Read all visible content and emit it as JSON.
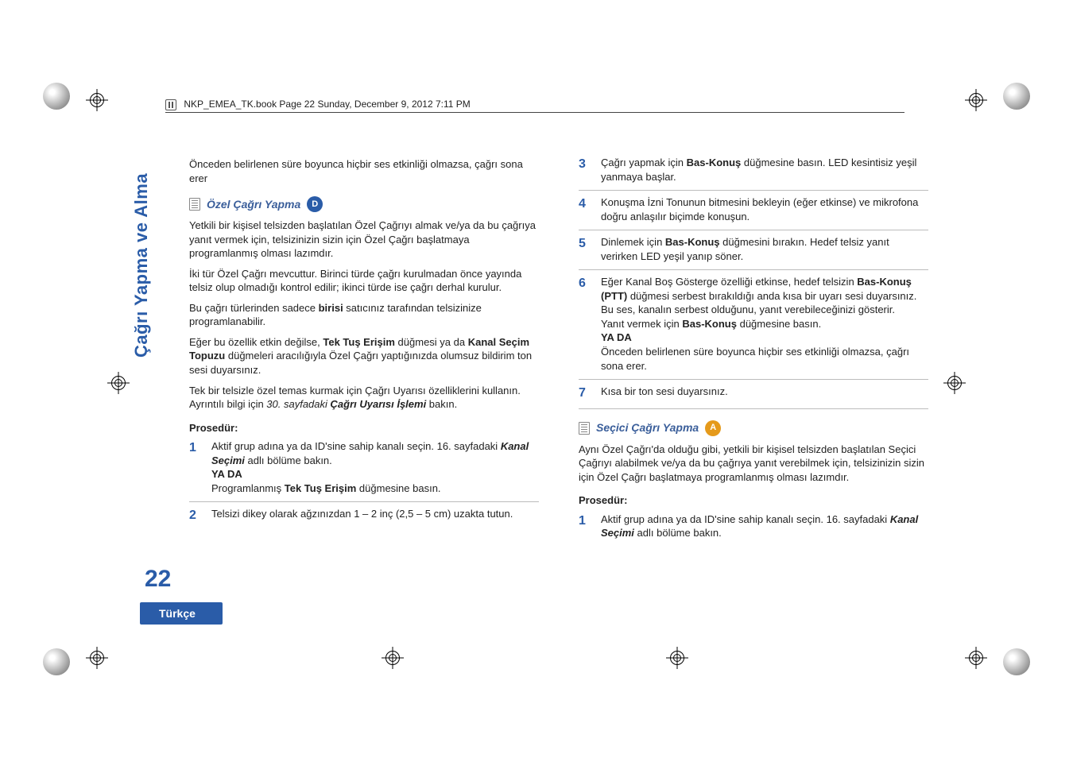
{
  "header": {
    "text": "NKP_EMEA_TK.book  Page 22  Sunday, December 9, 2012  7:11 PM"
  },
  "side_label": "Çağrı Yapma ve Alma",
  "page_number": "22",
  "language_tab": "Türkçe",
  "left": {
    "intro_continuation": "Önceden belirlenen süre boyunca hiçbir ses etkinliği olmazsa, çağrı sona erer",
    "heading": "Özel Çağrı Yapma",
    "badge": "D",
    "p1": "Yetkili bir kişisel telsizden başlatılan Özel Çağrıyı almak ve/ya da bu çağrıya yanıt vermek için, telsizinizin sizin için Özel Çağrı başlatmaya programlanmış olması lazımdır.",
    "p2": "İki tür Özel Çağrı mevcuttur. Birinci türde çağrı kurulmadan önce yayında telsiz olup olmadığı kontrol edilir; ikinci türde ise çağrı derhal kurulur.",
    "p3_a": "Bu çağrı türlerinden sadece ",
    "p3_bold": "birisi",
    "p3_b": " satıcınız tarafından telsizinize programlanabilir.",
    "p4_a": "Eğer bu özellik etkin değilse, ",
    "p4_b1": "Tek Tuş Erişim",
    "p4_b": " düğmesi ya da ",
    "p4_b2": "Kanal Seçim Topuzu",
    "p4_c": " düğmeleri aracılığıyla Özel Çağrı yaptığınızda olumsuz bildirim ton sesi duyarsınız.",
    "p5_a": "Tek bir telsizle özel temas kurmak için Çağrı Uyarısı özelliklerini kullanın. Ayrıntılı bilgi için ",
    "p5_i": "30. sayfadaki ",
    "p5_bi": "Çağrı Uyarısı İşlemi",
    "p5_b": " bakın.",
    "procedure_label": "Prosedür:",
    "steps": [
      {
        "num": "1",
        "a": "Aktif grup adına ya da ID'sine sahip kanalı seçin. 16. sayfadaki ",
        "bi": "Kanal Seçimi",
        "b": " adlı bölüme bakın.",
        "or": "YA DA",
        "c1": "Programlanmış ",
        "c_bold": "Tek Tuş Erişim",
        "c2": " düğmesine basın."
      },
      {
        "num": "2",
        "a": "Telsizi dikey olarak ağzınızdan 1 – 2 inç (2,5 – 5 cm) uzakta tutun."
      }
    ]
  },
  "right": {
    "steps": [
      {
        "num": "3",
        "a": "Çağrı yapmak için ",
        "bold": "Bas-Konuş",
        "b": " düğmesine basın. LED kesintisiz yeşil yanmaya başlar."
      },
      {
        "num": "4",
        "a": "Konuşma İzni Tonunun bitmesini bekleyin (eğer etkinse) ve mikrofona doğru anlaşılır biçimde konuşun."
      },
      {
        "num": "5",
        "a": "Dinlemek için ",
        "bold": "Bas-Konuş",
        "b": " düğmesini bırakın. Hedef telsiz yanıt verirken LED yeşil yanıp söner."
      },
      {
        "num": "6",
        "a": "Eğer Kanal Boş Gösterge özelliği etkinse, hedef telsizin ",
        "bold1": "Bas-Konuş (PTT)",
        "b": " düğmesi serbest bırakıldığı anda kısa bir uyarı sesi duyarsınız. Bu ses, kanalın serbest olduğunu, yanıt verebileceğinizi gösterir.",
        "c1": "Yanıt vermek için ",
        "bold2": "Bas-Konuş",
        "c2": " düğmesine basın.",
        "or": "YA DA",
        "d": "Önceden belirlenen süre boyunca hiçbir ses etkinliği olmazsa, çağrı sona erer."
      },
      {
        "num": "7",
        "a": "Kısa bir ton sesi duyarsınız."
      }
    ],
    "heading2": "Seçici Çağrı Yapma",
    "badge2": "A",
    "p1": "Aynı Özel Çağrı'da olduğu gibi, yetkili bir kişisel telsizden başlatılan Seçici Çağrıyı alabilmek ve/ya da bu çağrıya yanıt verebilmek için, telsizinizin sizin için Özel Çağrı başlatmaya programlanmış olması lazımdır.",
    "procedure_label": "Prosedür:",
    "step1": {
      "num": "1",
      "a": "Aktif grup adına ya da ID'sine sahip kanalı seçin. 16. sayfadaki ",
      "bi": "Kanal Seçimi",
      "b": " adlı bölüme bakın."
    }
  }
}
